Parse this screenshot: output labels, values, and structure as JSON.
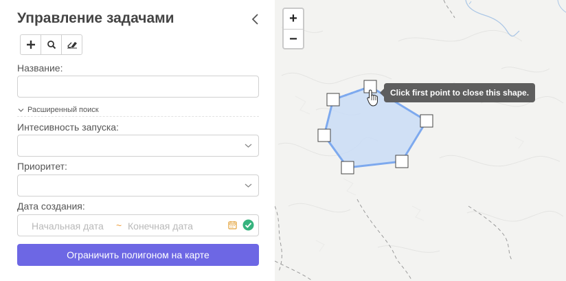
{
  "panel": {
    "title": "Управление задачами",
    "toolbar": [
      {
        "icon": "plus-icon"
      },
      {
        "icon": "search-icon"
      },
      {
        "icon": "eraser-icon"
      }
    ]
  },
  "form": {
    "name_label": "Название:",
    "name_value": "",
    "advanced_search_label": "Расширенный поиск",
    "intensity_label": "Интесивность запуска:",
    "intensity_value": "",
    "priority_label": "Приоритет:",
    "priority_value": "",
    "created_label": "Дата создания:",
    "start_date_placeholder": "Начальная дата",
    "range_separator": "~",
    "end_date_placeholder": "Конечная дата",
    "polygon_button": "Ограничить полигоном на карте"
  },
  "map": {
    "zoom_in": "+",
    "zoom_out": "−",
    "tooltip": "Click first point to close this shape."
  },
  "colors": {
    "accent": "#6d67e4",
    "polygon_stroke": "#7da9ee",
    "polygon_fill": "#c9dcf6",
    "ok_green": "#36b37e"
  }
}
